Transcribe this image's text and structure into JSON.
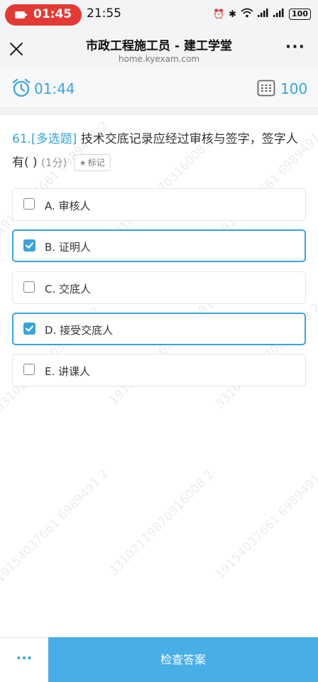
{
  "status_bar": {
    "recording_time": "01:45",
    "clock": "21:55",
    "battery": "100"
  },
  "header": {
    "title": "市政工程施工员 - 建工学堂",
    "url": "home.kyexam.com",
    "more_label": "···"
  },
  "timer": {
    "elapsed": "01:44",
    "question_count": "100"
  },
  "question": {
    "number": "61.",
    "type": "[多选题]",
    "text": "技术交底记录应经过审核与签字，签字人有( )",
    "score": "(1分)",
    "mark_label": "标记"
  },
  "options": [
    {
      "label": "A. 审核人",
      "checked": false
    },
    {
      "label": "B. 证明人",
      "checked": true
    },
    {
      "label": "C. 交底人",
      "checked": false
    },
    {
      "label": "D. 接受交底人",
      "checked": true
    },
    {
      "label": "E. 讲课人",
      "checked": false
    }
  ],
  "watermark": {
    "line_a": "19154037661 6989491 2",
    "line_b": "33102119870316008 2"
  },
  "bottom": {
    "menu_label": "···",
    "check_label": "检查答案"
  },
  "colors": {
    "accent": "#3aa3dc",
    "button": "#48aee6"
  }
}
